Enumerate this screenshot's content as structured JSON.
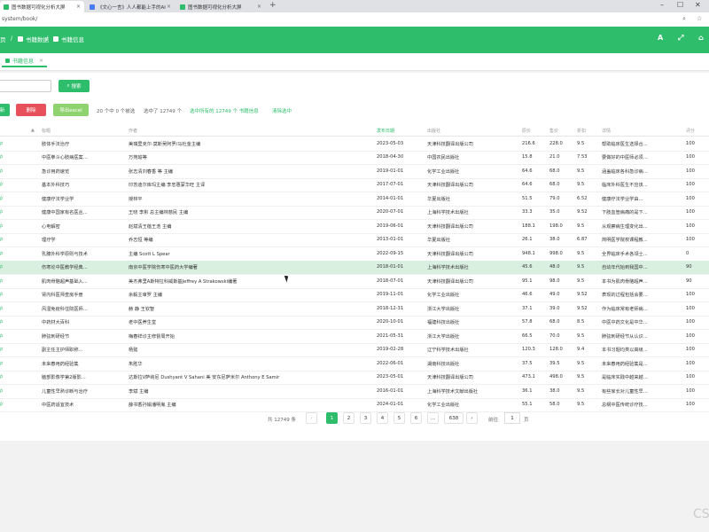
{
  "browser": {
    "tabs": [
      {
        "title": "图书数据可视化分析大屏",
        "fav": "#2ebd6b"
      },
      {
        "title": "《文心一言》人人都能上手的AI",
        "fav": "#4a7cf0"
      },
      {
        "title": "图书数据可视化分析大屏",
        "fav": "#2ebd6b"
      }
    ],
    "url": "system/book/",
    "new_tab": "+",
    "win_controls": [
      "–",
      "☐",
      "✕"
    ]
  },
  "header": {
    "breadcrumbs": [
      "页",
      "书籍数据",
      "书籍信息"
    ],
    "separator": "/",
    "right_icons": [
      "A",
      "⤢",
      "⌂"
    ]
  },
  "page_tab": {
    "label": "书籍信息",
    "close": "×"
  },
  "toolbar": {
    "search_label": "搜索",
    "add_label": "新",
    "delete_label": "删除",
    "export_label": "导出excel",
    "selection_text": "20 个中 0 个被选",
    "selected_text": "选中了 12749 个",
    "select_all_text": "选中所有的 12749 个 书籍信息",
    "clear_text": "清除选中"
  },
  "table": {
    "headers": [
      "",
      "标题",
      "作者",
      "发布日期",
      "出版社",
      "原价",
      "售价",
      "折扣",
      "详情",
      "评分"
    ],
    "rows": [
      [
        "护",
        "肢体手法治疗",
        "美瑞里克尔·莫斯吴阿罗/马杜金主编",
        "2023-05-03",
        "天津科技翻译出版公司",
        "216.6",
        "228.0",
        "9.5",
        "帮助临床医生选择合...",
        "100"
      ],
      [
        "护",
        "中医拳斗心肢病医案...",
        "万苑瑜等",
        "2018-04-30",
        "中国农民出版社",
        "15.8",
        "21.0",
        "7.53",
        "要做好的中医师必须...",
        "100"
      ],
      [
        "护",
        "急诊用药速览",
        "张志清刘春香 等 主编",
        "2019-01-01",
        "化学工业出版社",
        "64.6",
        "68.0",
        "9.5",
        "涵盖临床各科急诊病...",
        "100"
      ],
      [
        "护",
        "基本外科技巧",
        "印苏迪尔库玛主编 李忠惠蒙华旺 主译",
        "2017-07-01",
        "天津科技翻译出版公司",
        "64.6",
        "68.0",
        "9.5",
        "临床外科医生不应该...",
        "100"
      ],
      [
        "护",
        "健康疗法学业学",
        "授林平",
        "2014-01-01",
        "华夏出版社",
        "51.5",
        "79.0",
        "6.52",
        "健康疗法学业学由...",
        "100"
      ],
      [
        "护",
        "健康中国家有名医丛...",
        "王晓 李彬 总主编林慈民 主编",
        "2020-07-01",
        "上海科学技术出版社",
        "33.3",
        "35.0",
        "9.52",
        "下肢血管病痛的是下...",
        "100"
      ],
      [
        "护",
        "心电解密",
        "赵斌清王蓓王浩 主编",
        "2019-06-01",
        "天津科技翻译出版公司",
        "188.1",
        "198.0",
        "9.5",
        "从观察病生理变化出...",
        "100"
      ],
      [
        "护",
        "理疗学",
        "乔志恒 等编",
        "2013-01-01",
        "华夏出版社",
        "26.1",
        "38.0",
        "6.87",
        "简明医学院校课程教...",
        "100"
      ],
      [
        "护",
        "乳腺外科学原则与技术",
        "主编 Scott L Spear",
        "2022-09-15",
        "天津科技翻译出版公司",
        "948.1",
        "998.0",
        "9.5",
        "全界临床手术各领士...",
        "0"
      ],
      [
        "护",
        "伤寒论中医教学经典...",
        "南京中医学院伤寒中医药大学编著",
        "2018-01-01",
        "上海科学技术出版社",
        "45.6",
        "48.0",
        "9.5",
        "自幼年代始到我国中...",
        "90"
      ],
      [
        "护",
        "肌肉骨骼超声基础入...",
        "美杰弗里A斯特拉科威斯基Jeffrey A Strakowski编著",
        "2018-07-01",
        "天津科技翻译出版公司",
        "95.1",
        "98.0",
        "9.5",
        "本书为肌肉骨骼超声...",
        "90"
      ],
      [
        "护",
        "肾内科医师查房手册",
        "余毅主审罗 主编",
        "2019-11-01",
        "化学工业出版社",
        "46.6",
        "49.0",
        "9.52",
        "表现的过程包括会要...",
        "100"
      ],
      [
        "护",
        "风湿免疫科住院医师...",
        "赫 静 王钦智",
        "2018-12-31",
        "浙江大学出版社",
        "37.1",
        "39.0",
        "9.52",
        "作为临床常有老师病...",
        "100"
      ],
      [
        "护",
        "中药材大百科",
        "老中医养生堂",
        "2020-10-01",
        "福建科技出版社",
        "57.8",
        "68.0",
        "8.5",
        "中医中药文化是中华...",
        "100"
      ],
      [
        "护",
        "肺弦刺研经节",
        "梅春祥诊主修督周开始",
        "2021-05-31",
        "浙江大学出版社",
        "66.5",
        "70.0",
        "9.5",
        "肺弦刺研经节从认识...",
        "100"
      ],
      [
        "护",
        "副主任主护师职称...",
        "杨懿",
        "2019-02-28",
        "辽宁科学技术出版社",
        "120.3",
        "128.0",
        "9.4",
        "本书习题均类以高级...",
        "100"
      ],
      [
        "护",
        "未来春用药经验集",
        "朱胜华",
        "2022-06-01",
        "湖南科技出版社",
        "37.5",
        "39.5",
        "9.5",
        "未来春用药经验集是...",
        "100"
      ],
      [
        "护",
        "脑部影像学第2版影...",
        "达斯拉V萨纳尼 Dushyant V Sahani 美 安东尼萨米尔 Anthony E Samir",
        "2023-05-01",
        "天津科技翻译出版公司",
        "473.1",
        "498.0",
        "9.5",
        "是临床实践中越来越...",
        "100"
      ],
      [
        "护",
        "儿童性早熟诊断与治疗",
        "李斌 主编",
        "2016-01-01",
        "上海科学技术文献出版社",
        "36.1",
        "38.0",
        "9.5",
        "有些家长对儿童性早...",
        "100"
      ],
      [
        "护",
        "中医药适宜技术",
        "薛书香孙娟潘明胤 主编",
        "2024-01-01",
        "化学工业出版社",
        "55.1",
        "58.0",
        "9.5",
        "总纲中医传统诊疗技...",
        "100"
      ]
    ]
  },
  "pagination": {
    "total_text": "共 12749 条",
    "prev": "‹",
    "pages": [
      "1",
      "2",
      "3",
      "4",
      "5",
      "6"
    ],
    "ellipsis": "...",
    "last": "638",
    "next": "›",
    "goto_label": "前往",
    "goto_value": "1",
    "page_unit": "页"
  },
  "watermark": "CS",
  "colors": {
    "brand": "#2ebd6b",
    "danger": "#e8505b",
    "export": "#8fd36f",
    "highlight_row": "#d9f0e1"
  }
}
